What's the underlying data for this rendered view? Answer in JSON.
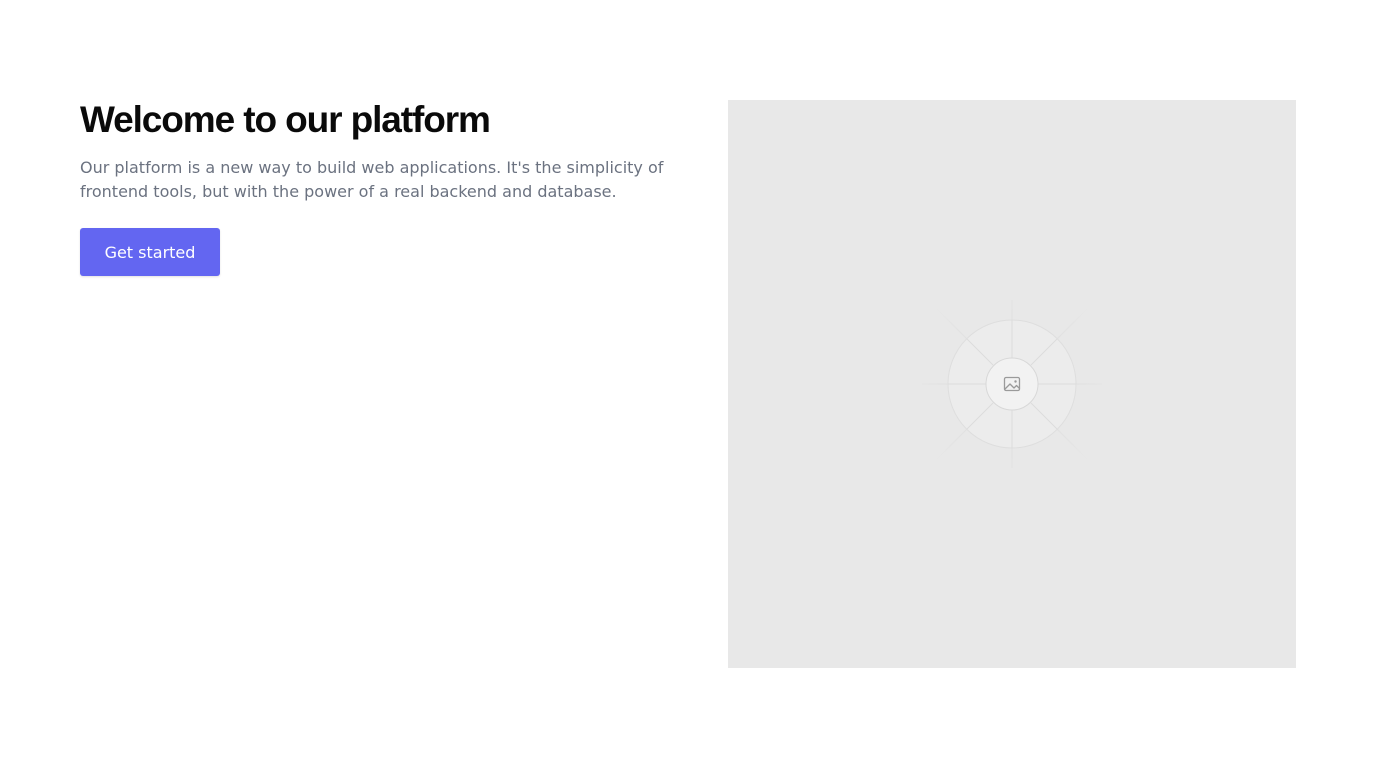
{
  "hero": {
    "title": "Welcome to our platform",
    "description": "Our platform is a new way to build web applications. It's the simplicity of frontend tools, but with the power of a real backend and database.",
    "cta_label": "Get started"
  },
  "image_placeholder": {
    "icon": "image-icon"
  },
  "colors": {
    "accent": "#6366f1",
    "title": "#0a0a0a",
    "body_text": "#6b7280",
    "placeholder_bg": "#e8e8e8"
  }
}
